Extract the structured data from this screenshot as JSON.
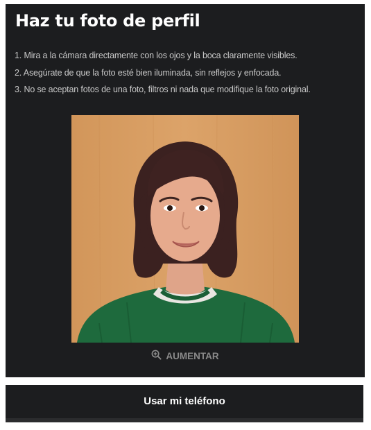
{
  "header": {
    "title": "Haz tu foto de perfil"
  },
  "instructions": [
    "1. Mira a la cámara directamente con los ojos y la boca claramente visibles.",
    "2. Asegúrate de que la foto esté bien iluminada, sin reflejos y enfocada.",
    "3. No se aceptan fotos de una foto, filtros ni nada que modifique la foto original."
  ],
  "photo": {
    "zoom_label": "AUMENTAR",
    "zoom_icon": "zoom-in-icon"
  },
  "actions": {
    "use_phone_label": "Usar mi teléfono"
  },
  "colors": {
    "panel_background": "#1c1d1f",
    "photo_background": "#d59a5e",
    "sweater": "#1e6a3d"
  }
}
